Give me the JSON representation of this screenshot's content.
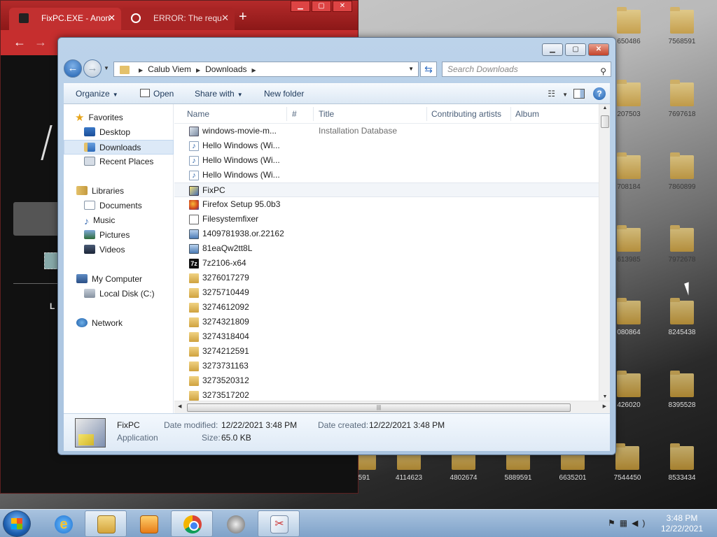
{
  "browser": {
    "tabs": [
      {
        "label": "FixPC.EXE - Anon",
        "active": true
      },
      {
        "label": "ERROR: The requ",
        "active": false
      }
    ],
    "partial_text": "L"
  },
  "desktop_labels": {
    "r1": [
      "650486",
      "7568591"
    ],
    "r2": [
      "207503",
      "7697618"
    ],
    "r3": [
      "708184",
      "7860899"
    ],
    "r4": [
      "613985",
      "7972678"
    ],
    "r5": [
      "080864",
      "8245438"
    ],
    "r6": [
      "426020",
      "8395528"
    ],
    "bottom": [
      "591",
      "4114623",
      "4802674",
      "5889591",
      "6635201",
      "7544450",
      "8533434"
    ]
  },
  "explorer": {
    "address": {
      "segments": [
        "Calub Viem",
        "Downloads"
      ]
    },
    "search_placeholder": "Search Downloads",
    "toolbar": {
      "organize": "Organize",
      "open": "Open",
      "share_with": "Share with",
      "new_folder": "New folder"
    },
    "nav": {
      "favorites": "Favorites",
      "desktop": "Desktop",
      "downloads": "Downloads",
      "recent": "Recent Places",
      "libraries": "Libraries",
      "documents": "Documents",
      "music": "Music",
      "pictures": "Pictures",
      "videos": "Videos",
      "computer": "My Computer",
      "disk": "Local Disk (C:)",
      "network": "Network"
    },
    "columns": {
      "name": "Name",
      "num": "#",
      "title": "Title",
      "artists": "Contributing artists",
      "album": "Album"
    },
    "files": [
      {
        "name": "windows-movie-m...",
        "title": "Installation Database",
        "icon": "msi-icon"
      },
      {
        "name": "Hello Windows (Wi...",
        "title": "",
        "icon": "audio-file-icon"
      },
      {
        "name": "Hello Windows (Wi...",
        "title": "",
        "icon": "audio-file-icon"
      },
      {
        "name": "Hello Windows (Wi...",
        "title": "",
        "icon": "audio-file-icon"
      },
      {
        "name": "FixPC",
        "title": "",
        "icon": "application-icon",
        "highlighted": true
      },
      {
        "name": "Firefox Setup 95.0b3",
        "title": "",
        "icon": "firefox-icon"
      },
      {
        "name": "Filesystemfixer",
        "title": "",
        "icon": "generic-file-icon"
      },
      {
        "name": "1409781938.or.22162",
        "title": "",
        "icon": "image-file-icon"
      },
      {
        "name": "81eaQw2tt8L",
        "title": "",
        "icon": "image-file-icon"
      },
      {
        "name": "7z2106-x64",
        "title": "",
        "icon": "7zip-icon"
      },
      {
        "name": "3276017279",
        "title": "",
        "icon": "folder-icon"
      },
      {
        "name": "3275710449",
        "title": "",
        "icon": "folder-icon"
      },
      {
        "name": "3274612092",
        "title": "",
        "icon": "folder-icon"
      },
      {
        "name": "3274321809",
        "title": "",
        "icon": "folder-icon"
      },
      {
        "name": "3274318404",
        "title": "",
        "icon": "folder-icon"
      },
      {
        "name": "3274212591",
        "title": "",
        "icon": "folder-icon"
      },
      {
        "name": "3273731163",
        "title": "",
        "icon": "folder-icon"
      },
      {
        "name": "3273520312",
        "title": "",
        "icon": "folder-icon"
      },
      {
        "name": "3273517202",
        "title": "",
        "icon": "folder-icon"
      }
    ],
    "details": {
      "name": "FixPC",
      "type": "Application",
      "modified_label": "Date modified:",
      "modified": "12/22/2021 3:48 PM",
      "created_label": "Date created:",
      "created": "12/22/2021 3:48 PM",
      "size_label": "Size:",
      "size": "65.0 KB"
    }
  },
  "taskbar": {
    "time": "3:48 PM",
    "date": "12/22/2021"
  }
}
